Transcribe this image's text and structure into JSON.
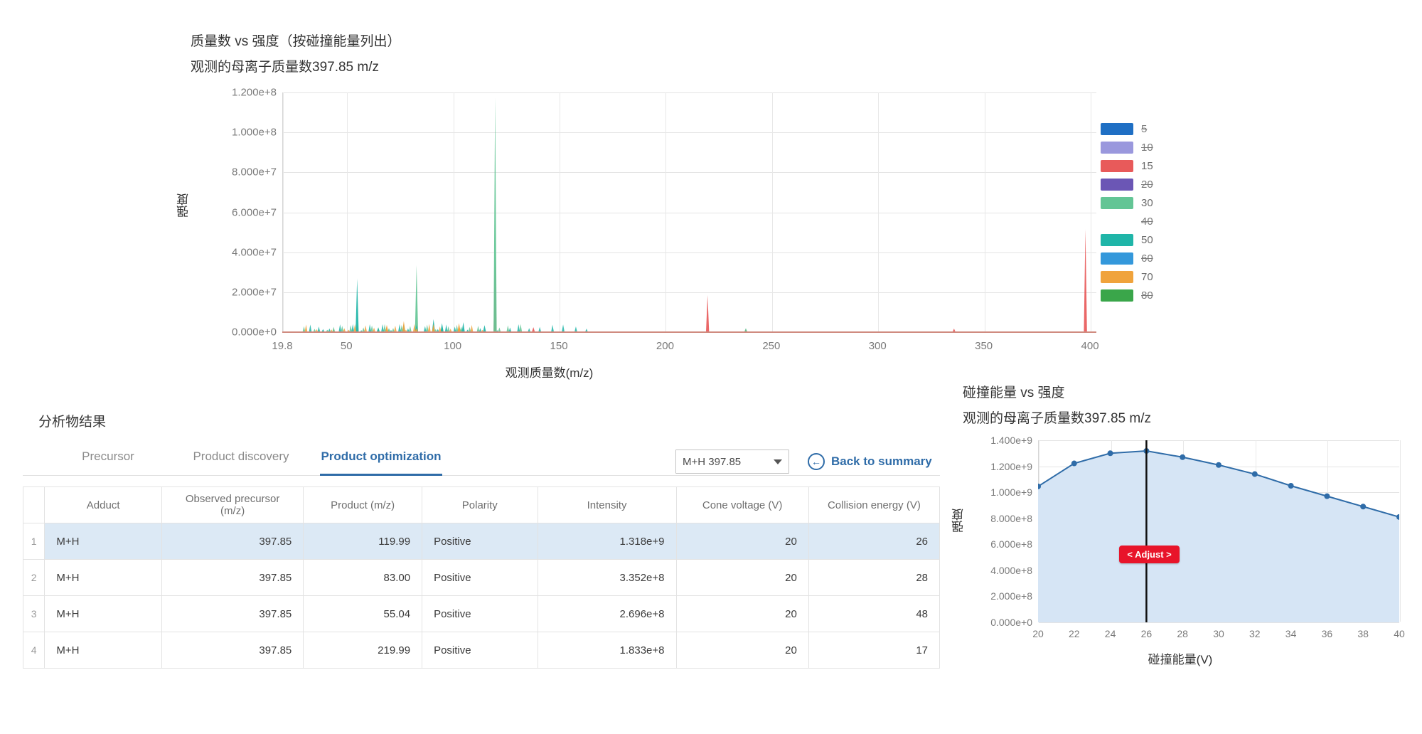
{
  "spectrum": {
    "title": "质量数 vs 强度（按碰撞能量列出）",
    "subtitle": "观测的母离子质量数397.85 m/z",
    "xlabel": "观测质量数(m/z)",
    "ylabel": "强度",
    "yticks": [
      "1.200e+8",
      "1.000e+8",
      "8.000e+7",
      "6.000e+7",
      "4.000e+7",
      "2.000e+7",
      "0.000e+0"
    ],
    "xticks": [
      "19.8",
      "50",
      "100",
      "150",
      "200",
      "250",
      "300",
      "350",
      "400"
    ],
    "legend": [
      {
        "label": "5",
        "color": "#1f6fc4",
        "hidden": true
      },
      {
        "label": "10",
        "color": "#9a98dd",
        "hidden": true
      },
      {
        "label": "15",
        "color": "#e85a5a",
        "hidden": false
      },
      {
        "label": "20",
        "color": "#6b56b5",
        "hidden": true
      },
      {
        "label": "30",
        "color": "#63c595",
        "hidden": false
      },
      {
        "label": "40",
        "color": "#e9c košice",
        "hidden": true
      },
      {
        "label": "50",
        "color": "#1fb5a8",
        "hidden": false
      },
      {
        "label": "60",
        "color": "#3498db",
        "hidden": true
      },
      {
        "label": "70",
        "color": "#f0a33c",
        "hidden": false
      },
      {
        "label": "80",
        "color": "#3aa64a",
        "hidden": true
      }
    ]
  },
  "chart_data": [
    {
      "type": "line",
      "name": "mass-vs-intensity-spectrum",
      "title": "质量数 vs 强度（按碰撞能量列出）",
      "subtitle": "观测的母离子质量数397.85 m/z",
      "xlabel": "观测质量数(m/z)",
      "ylabel": "强度",
      "xlim": [
        19.8,
        400
      ],
      "ylim": [
        0,
        120000000
      ],
      "grid": true,
      "legend_position": "right",
      "legend_entries": [
        "5",
        "10",
        "15",
        "20",
        "30",
        "40",
        "50",
        "60",
        "70",
        "80"
      ],
      "hidden_series": [
        "5",
        "10",
        "20",
        "40",
        "60",
        "80"
      ],
      "series": [
        {
          "name": "15",
          "color": "#e85a5a",
          "peaks": [
            {
              "mz": 55.0,
              "intensity": 1500000
            },
            {
              "mz": 83.0,
              "intensity": 2000000
            },
            {
              "mz": 119.99,
              "intensity": 39000000
            },
            {
              "mz": 138.0,
              "intensity": 2500000
            },
            {
              "mz": 219.99,
              "intensity": 18500000
            },
            {
              "mz": 238.0,
              "intensity": 1500000
            },
            {
              "mz": 336.0,
              "intensity": 1800000
            },
            {
              "mz": 397.85,
              "intensity": 51500000
            }
          ]
        },
        {
          "name": "30",
          "color": "#63c595",
          "peaks": [
            {
              "mz": 41.0,
              "intensity": 1200000
            },
            {
              "mz": 55.0,
              "intensity": 4000000
            },
            {
              "mz": 65.0,
              "intensity": 2500000
            },
            {
              "mz": 70.0,
              "intensity": 2000000
            },
            {
              "mz": 83.0,
              "intensity": 33500000
            },
            {
              "mz": 91.0,
              "intensity": 4500000
            },
            {
              "mz": 95.0,
              "intensity": 3500000
            },
            {
              "mz": 104.0,
              "intensity": 2800000
            },
            {
              "mz": 119.99,
              "intensity": 117500000
            },
            {
              "mz": 238.0,
              "intensity": 2000000
            }
          ]
        },
        {
          "name": "50",
          "color": "#1fb5a8",
          "peaks": [
            {
              "mz": 39.0,
              "intensity": 1500000
            },
            {
              "mz": 55.04,
              "intensity": 26900000
            },
            {
              "mz": 65.0,
              "intensity": 2200000
            },
            {
              "mz": 77.0,
              "intensity": 4500000
            },
            {
              "mz": 83.0,
              "intensity": 3500000
            },
            {
              "mz": 91.0,
              "intensity": 6500000
            },
            {
              "mz": 95.0,
              "intensity": 4500000
            },
            {
              "mz": 105.0,
              "intensity": 5000000
            },
            {
              "mz": 115.0,
              "intensity": 3500000
            }
          ]
        },
        {
          "name": "70",
          "color": "#f0a33c",
          "peaks": [
            {
              "mz": 44.0,
              "intensity": 1500000
            },
            {
              "mz": 51.0,
              "intensity": 1200000
            },
            {
              "mz": 69.0,
              "intensity": 3500000
            },
            {
              "mz": 77.0,
              "intensity": 5500000
            },
            {
              "mz": 83.0,
              "intensity": 2000000
            },
            {
              "mz": 91.0,
              "intensity": 4000000
            },
            {
              "mz": 103.0,
              "intensity": 4500000
            }
          ]
        }
      ]
    },
    {
      "type": "area",
      "name": "collision-energy-vs-intensity",
      "title": "碰撞能量 vs 强度",
      "subtitle": "观测的母离子质量数397.85 m/z",
      "xlabel": "碰撞能量(V)",
      "ylabel": "强度",
      "xlim": [
        20,
        40
      ],
      "ylim": [
        0,
        1400000000
      ],
      "grid": true,
      "line_color": "#2f6ca8",
      "fill_color": "#d6e5f5",
      "marker_line": {
        "x": 26,
        "label": "< Adjust >",
        "color": "#e8142a"
      },
      "x": [
        20,
        22,
        24,
        26,
        28,
        30,
        32,
        34,
        36,
        38,
        40
      ],
      "values": [
        1045000000,
        1222000000,
        1300000000,
        1318000000,
        1270000000,
        1210000000,
        1140000000,
        1050000000,
        970000000,
        890000000,
        810000000
      ],
      "xticks": [
        "20",
        "22",
        "24",
        "26",
        "28",
        "30",
        "32",
        "34",
        "36",
        "38",
        "40"
      ],
      "yticks": [
        "1.400e+9",
        "1.200e+9",
        "1.000e+9",
        "8.000e+8",
        "6.000e+8",
        "4.000e+8",
        "2.000e+8",
        "0.000e+0"
      ]
    }
  ],
  "results": {
    "heading": "分析物结果",
    "tabs": [
      {
        "label": "Precursor",
        "active": false
      },
      {
        "label": "Product discovery",
        "active": false
      },
      {
        "label": "Product optimization",
        "active": true
      }
    ],
    "adduct_select": {
      "value": "M+H 397.85"
    },
    "back_link": "Back to summary",
    "columns": [
      "Adduct",
      "Observed precursor (m/z)",
      "Product (m/z)",
      "Polarity",
      "Intensity",
      "Cone voltage (V)",
      "Collision energy (V)"
    ],
    "rows": [
      {
        "idx": "1",
        "adduct": "M+H",
        "observed": "397.85",
        "product": "119.99",
        "polarity": "Positive",
        "intensity": "1.318e+9",
        "cone": "20",
        "ce": "26",
        "selected": true
      },
      {
        "idx": "2",
        "adduct": "M+H",
        "observed": "397.85",
        "product": "83.00",
        "polarity": "Positive",
        "intensity": "3.352e+8",
        "cone": "20",
        "ce": "28",
        "selected": false
      },
      {
        "idx": "3",
        "adduct": "M+H",
        "observed": "397.85",
        "product": "55.04",
        "polarity": "Positive",
        "intensity": "2.696e+8",
        "cone": "20",
        "ce": "48",
        "selected": false
      },
      {
        "idx": "4",
        "adduct": "M+H",
        "observed": "397.85",
        "product": "219.99",
        "polarity": "Positive",
        "intensity": "1.833e+8",
        "cone": "20",
        "ce": "17",
        "selected": false
      }
    ]
  },
  "ce_chart": {
    "title": "碰撞能量 vs 强度",
    "subtitle": "观测的母离子质量数397.85 m/z",
    "xlabel": "碰撞能量(V)",
    "ylabel": "强度",
    "adjust_label": "< Adjust >"
  },
  "colors": {
    "accent": "#2f6ca8",
    "alert": "#e8142a",
    "selected_row": "#dce9f5"
  }
}
